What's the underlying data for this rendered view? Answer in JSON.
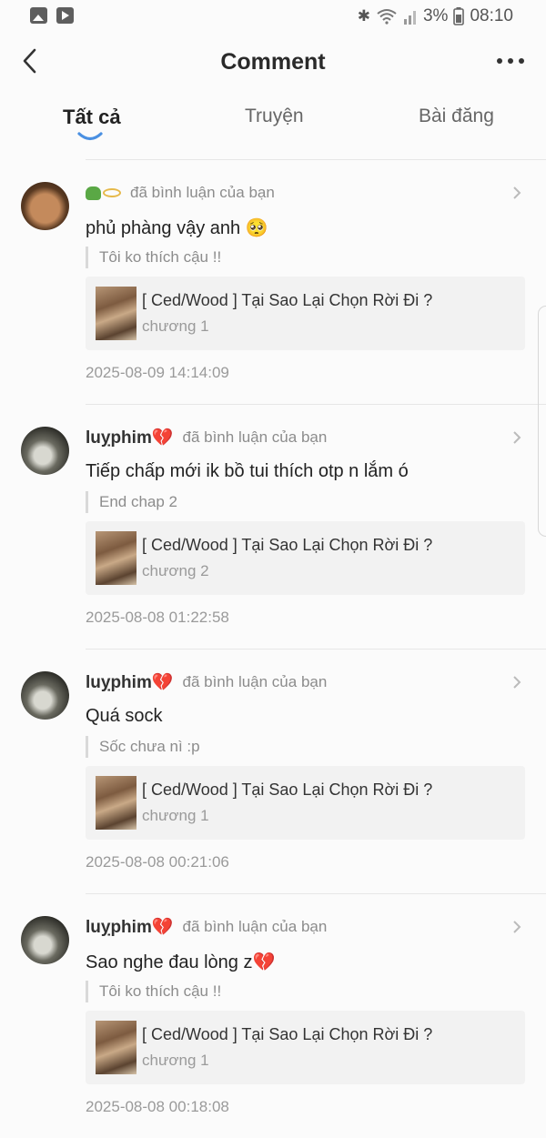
{
  "status_bar": {
    "left_icons": [
      "image-notification-icon",
      "play-notification-icon"
    ],
    "bluetooth": "✱",
    "battery_percent": "3%",
    "time": "08:10"
  },
  "header": {
    "title": "Comment"
  },
  "tabs": [
    {
      "label": "Tất cả",
      "active": true
    },
    {
      "label": "Truyện",
      "active": false
    },
    {
      "label": "Bài đăng",
      "active": false
    }
  ],
  "comments": [
    {
      "username": "",
      "badge": "frog-ring-emoji",
      "action": "đã bình luận của bạn",
      "text": "phủ phàng vậy anh 🥺",
      "quote": "Tôi ko thích cậu !!",
      "story_title": "[ Ced/Wood ] Tại Sao Lại Chọn Rời Đi ?",
      "chapter": "chương 1",
      "timestamp": "2025-08-09 14:14:09"
    },
    {
      "username": "luỵphim💔",
      "action": "đã bình luận của bạn",
      "text": "Tiếp chấp mới ik bồ tui thích otp n lắm ó",
      "quote": "End chap 2",
      "story_title": "[ Ced/Wood ] Tại Sao Lại Chọn Rời Đi ?",
      "chapter": "chương 2",
      "timestamp": "2025-08-08 01:22:58"
    },
    {
      "username": "luỵphim💔",
      "action": "đã bình luận của bạn",
      "text": "Quá sock",
      "quote": "Sốc chưa nì :p",
      "story_title": "[ Ced/Wood ] Tại Sao Lại Chọn Rời Đi ?",
      "chapter": "chương 1",
      "timestamp": "2025-08-08 00:21:06"
    },
    {
      "username": "luỵphim💔",
      "action": "đã bình luận của bạn",
      "text": "Sao nghe đau lòng z💔",
      "quote": "Tôi ko thích cậu !!",
      "story_title": "[ Ced/Wood ] Tại Sao Lại Chọn Rời Đi ?",
      "chapter": "chương 1",
      "timestamp": "2025-08-08 00:18:08"
    }
  ]
}
